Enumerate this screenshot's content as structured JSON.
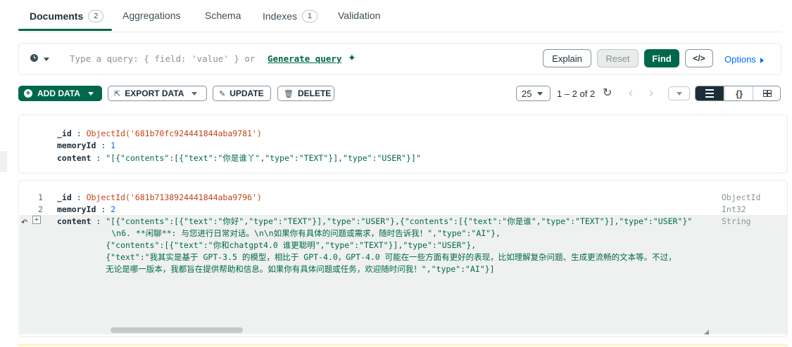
{
  "tabs": [
    {
      "label": "Documents",
      "count": "2"
    },
    {
      "label": "Aggregations"
    },
    {
      "label": "Schema"
    },
    {
      "label": "Indexes",
      "count": "1"
    },
    {
      "label": "Validation"
    }
  ],
  "query": {
    "placeholder": "Type a query: { field: 'value' } or",
    "generate_label": "Generate query",
    "explain": "Explain",
    "reset": "Reset",
    "find": "Find",
    "code_toggle": "</>",
    "options": "Options"
  },
  "toolbar": {
    "add_data": "ADD DATA",
    "export_data": "EXPORT DATA",
    "update": "UPDATE",
    "delete": "DELETE",
    "page_size": "25",
    "range": "1 – 2 of 2"
  },
  "documents": [
    {
      "fields": [
        {
          "key": "_id",
          "value": "ObjectId('681b70fc924441844aba9781')"
        },
        {
          "key": "memoryId",
          "value": "1"
        },
        {
          "key": "content",
          "value": "\"[{\"contents\":[{\"text\":\"你是谁丫\",\"type\":\"TEXT\"}],\"type\":\"USER\"}]\""
        }
      ]
    },
    {
      "fields": [
        {
          "line": "1",
          "key": "_id",
          "value": "ObjectId('681b7138924441844aba9796')",
          "type": "ObjectId"
        },
        {
          "line": "2",
          "key": "memoryId",
          "value": "2",
          "type": "Int32"
        },
        {
          "key": "content",
          "type": "String",
          "lines": [
            "\"[{\"contents\":[{\"text\":\"你好\",\"type\":\"TEXT\"}],\"type\":\"USER\"},{\"contents\":[{\"text\":\"你是谁\",\"type\":\"TEXT\"}],\"type\":\"USER\"}\"",
            "\\n6. **闲聊**: 与您进行日常对话。\\n\\n如果你有具体的问题或需求，随时告诉我！\",\"type\":\"AI\"},",
            "{\"contents\":[{\"text\":\"你和chatgpt4.0 谁更聪明\",\"type\":\"TEXT\"}],\"type\":\"USER\"},",
            "{\"text\":\"我其实是基于 GPT-3.5 的模型，相比于 GPT-4.0，GPT-4.0 可能在一些方面有更好的表现，比如理解复杂问题、生成更流畅的文本等。不过，",
            "无论是哪一版本，我都旨在提供帮助和信息。如果你有具体问题或任务，欢迎随时问我！\",\"type\":\"AI\"}]"
          ]
        }
      ]
    }
  ]
}
